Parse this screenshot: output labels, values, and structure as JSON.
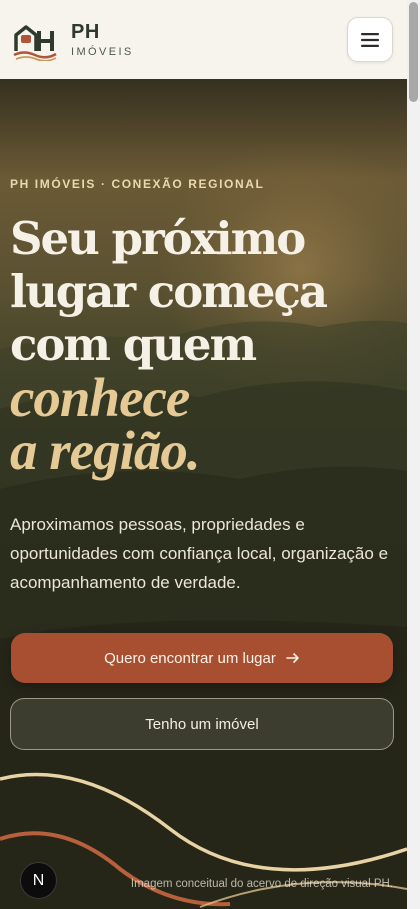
{
  "header": {
    "brand_name": "PH",
    "brand_sub": "IMÓVEIS",
    "logo_icon": "ph-house-logo-icon",
    "menu_icon": "hamburger-menu-icon"
  },
  "hero": {
    "eyebrow": "PH IMÓVEIS · CONEXÃO REGIONAL",
    "headline_lines": [
      "Seu próximo",
      "lugar começa",
      "com quem"
    ],
    "headline_accent": [
      "conhece",
      "a região."
    ],
    "lead": "Aproximamos pessoas, propriedades e oportunidades com confiança local, organização e acompanhamento de verdade.",
    "cta_primary": "Quero encontrar um lugar",
    "cta_primary_icon": "arrow-right-icon",
    "cta_secondary": "Tenho um imóvel",
    "caption": "Imagem conceitual do acervo de direção visual PH."
  },
  "badge": {
    "label": "N"
  },
  "colors": {
    "header_bg": "#f7f4ee",
    "accent_gold": "#e5ca96",
    "cta_primary_bg": "#a84f31",
    "brand_green": "#2f3a2c"
  }
}
